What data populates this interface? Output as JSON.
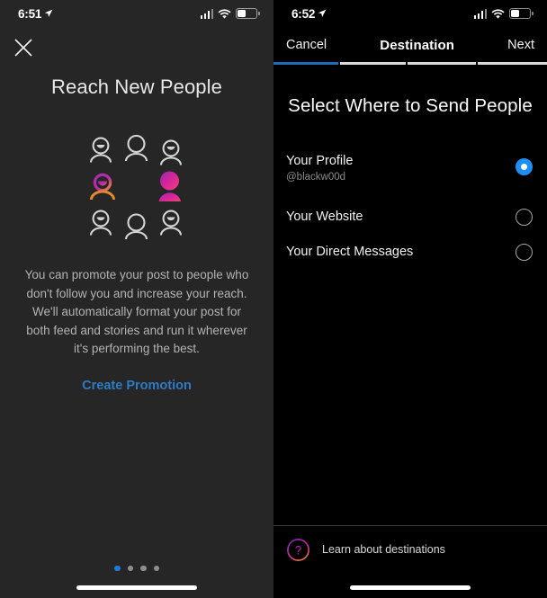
{
  "colors": {
    "left_panel_bg": "#262626",
    "right_panel_bg": "#000000",
    "accent_blue": "#1f8ff5",
    "link_blue": "#2d7bc4",
    "progress_done": "#1a6dbb",
    "muted_text": "#b3b3b3",
    "gradient_pink": "#e0218a",
    "gradient_purple": "#a02ca8",
    "gradient_orange": "#e08a2e"
  },
  "left_panel": {
    "statusbar": {
      "time": "6:51",
      "location_icon": "location-arrow-icon",
      "signal_icon": "cellular-signal-icon",
      "wifi_icon": "wifi-icon",
      "battery_icon": "battery-icon"
    },
    "close_icon": "close-icon",
    "title": "Reach New People",
    "illustration_name": "group-of-people-illustration",
    "body": "You can promote your post to people who don't follow you and increase your reach. We'll automatically format your post for both feed and stories and run it wherever it's performing the best.",
    "cta_label": "Create Promotion",
    "pager": {
      "count": 4,
      "active_index": 0
    }
  },
  "right_panel": {
    "statusbar": {
      "time": "6:52",
      "location_icon": "location-arrow-icon",
      "signal_icon": "cellular-signal-icon",
      "wifi_icon": "wifi-icon",
      "battery_icon": "battery-icon"
    },
    "navbar": {
      "cancel_label": "Cancel",
      "title": "Destination",
      "next_label": "Next"
    },
    "progress": {
      "steps": 4,
      "completed": 1
    },
    "heading": "Select Where to Send People",
    "options": [
      {
        "label": "Your Profile",
        "sub": "@blackw00d",
        "selected": true
      },
      {
        "label": "Your Website",
        "sub": "",
        "selected": false
      },
      {
        "label": "Your Direct Messages",
        "sub": "",
        "selected": false
      }
    ],
    "footer": {
      "icon": "question-mark-circle-icon",
      "label": "Learn about destinations"
    }
  }
}
